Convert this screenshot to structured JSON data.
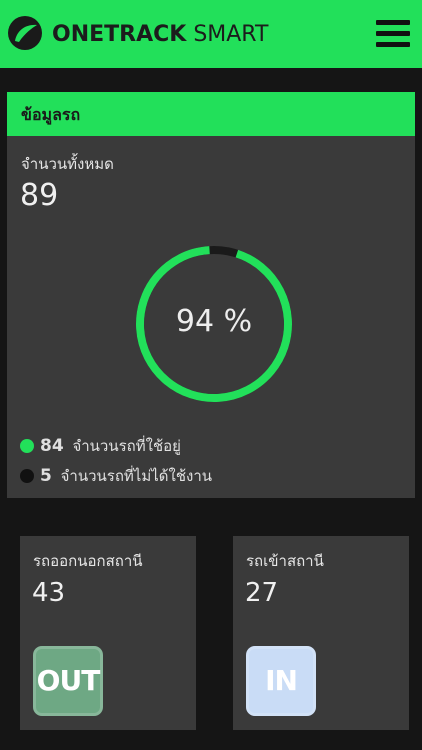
{
  "header": {
    "brand_bold": "ONETRACK",
    "brand_light": "SMART",
    "logo_icon": "leaf-logo-icon",
    "menu_icon": "hamburger-menu-icon",
    "accent_color": "#22e05a"
  },
  "vehicle_info": {
    "title": "ข้อมูลรถ",
    "total_label": "จำนวนทั้งหมด",
    "total_value": "89",
    "usage_percent": 94,
    "usage_text": "94 %",
    "legend": [
      {
        "count": "84",
        "label": "จำนวนรถที่ใช้อยู่",
        "color": "#22e05a"
      },
      {
        "count": "5",
        "label": "จำนวนรถที่ไม่ได้ใช้งาน",
        "color": "#111111"
      }
    ]
  },
  "cards": {
    "out": {
      "label": "รถออกนอกสถานี",
      "value": "43",
      "button": "OUT",
      "button_color": "#6ea884"
    },
    "in": {
      "label": "รถเข้าสถานี",
      "value": "27",
      "button": "IN",
      "button_color": "#c9dcf6"
    }
  }
}
